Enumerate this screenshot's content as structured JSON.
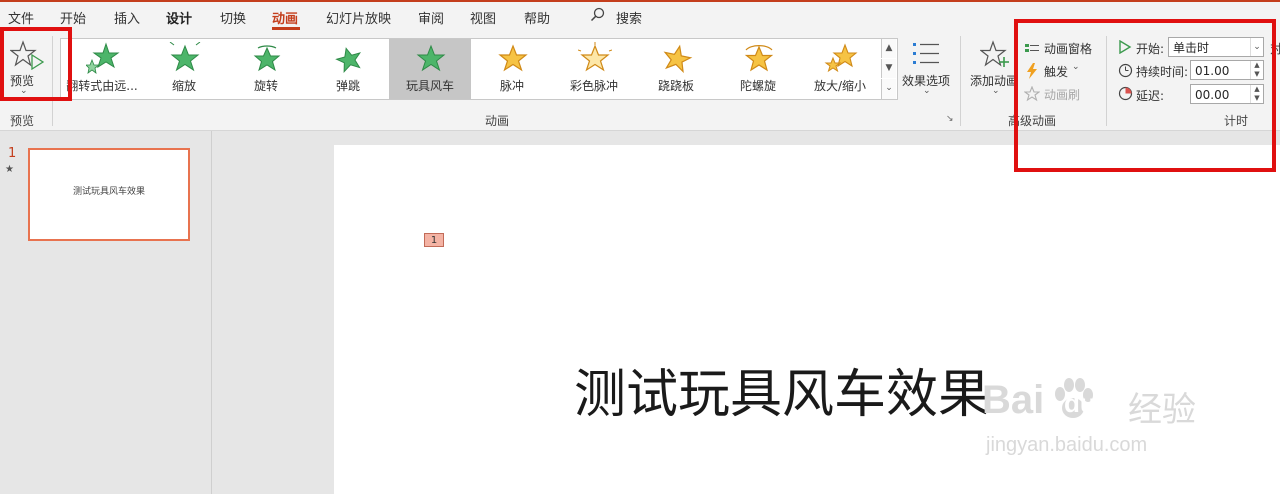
{
  "menu": {
    "items": [
      "文件",
      "开始",
      "插入",
      "设计",
      "切换",
      "动画",
      "幻灯片放映",
      "审阅",
      "视图",
      "帮助"
    ],
    "search_label": "搜索"
  },
  "preview": {
    "label": "预览",
    "group_label": "预览"
  },
  "gallery": {
    "items": [
      {
        "label": "翻转式由远...",
        "color": "#4db56a"
      },
      {
        "label": "缩放",
        "color": "#4db56a"
      },
      {
        "label": "旋转",
        "color": "#4db56a"
      },
      {
        "label": "弹跳",
        "color": "#4db56a"
      },
      {
        "label": "玩具风车",
        "color": "#4db56a"
      },
      {
        "label": "脉冲",
        "color": "#f0b429"
      },
      {
        "label": "彩色脉冲",
        "color": "#f0b429"
      },
      {
        "label": "跷跷板",
        "color": "#f0b429"
      },
      {
        "label": "陀螺旋",
        "color": "#f0b429"
      },
      {
        "label": "放大/缩小",
        "color": "#f0b429"
      }
    ],
    "selected_index": 4,
    "group_label": "动画"
  },
  "effects": {
    "label": "效果选项"
  },
  "advanced": {
    "add_animation": "添加动画",
    "animation_pane": "动画窗格",
    "trigger": "触发",
    "painter": "动画刷",
    "group_label": "高级动画"
  },
  "timing": {
    "start_label": "开始:",
    "start_value": "单击时",
    "duration_label": "持续时间:",
    "duration_value": "01.00",
    "delay_label": "延迟:",
    "delay_value": "00.00",
    "group_label": "计时",
    "reorder_partial": "对"
  },
  "slides": [
    {
      "number": "1",
      "star": "★",
      "title": "测试玩具风车效果"
    }
  ],
  "slide": {
    "animation_badge": "1",
    "title": "测试玩具风车效果"
  },
  "watermark": {
    "logo_left": "Bai",
    "logo_right": "du",
    "brand": "经验",
    "url": "jingyan.baidu.com"
  },
  "colors": {
    "accent": "#c43e1c",
    "highlight_box": "#e01010",
    "thumb_border": "#e8734f"
  }
}
